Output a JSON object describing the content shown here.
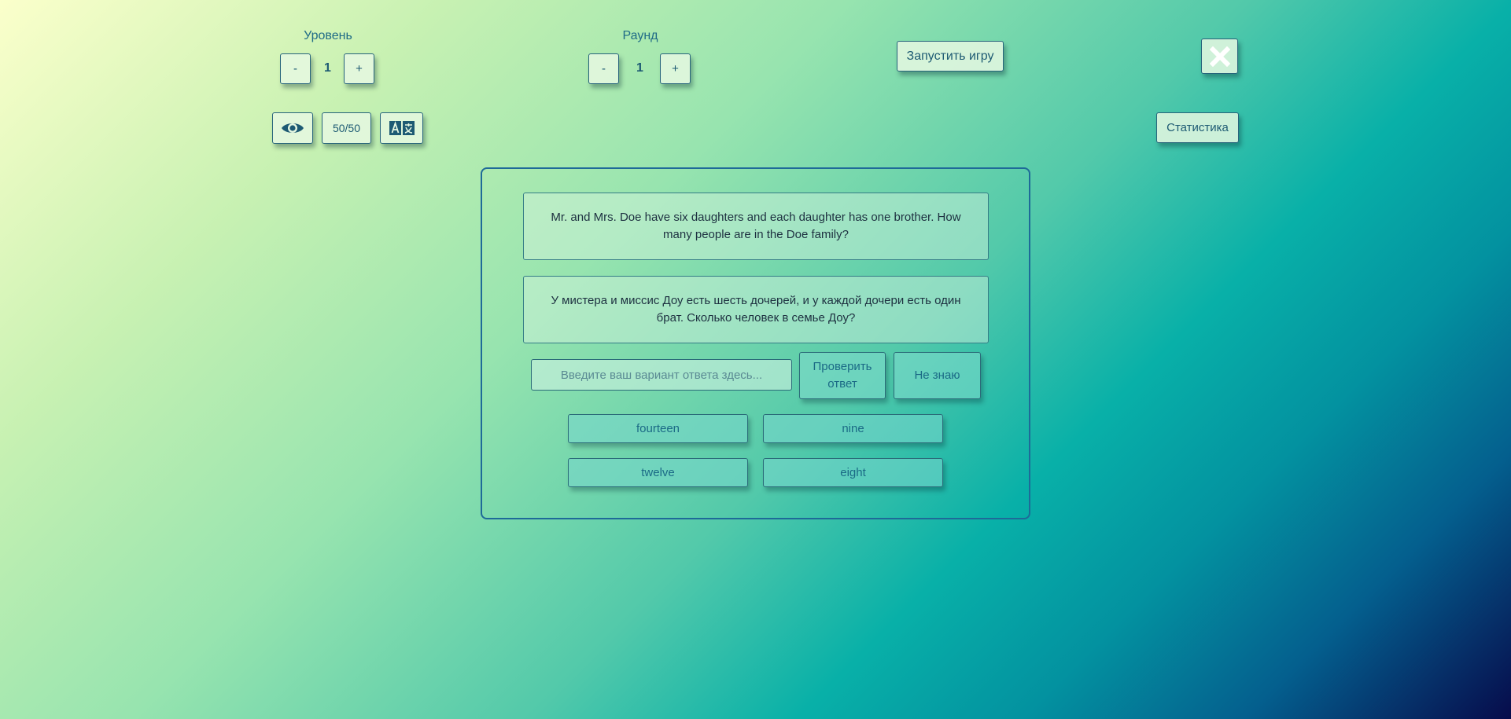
{
  "level": {
    "label": "Уровень",
    "minus": "-",
    "value": "1",
    "plus": "+"
  },
  "round": {
    "label": "Раунд",
    "minus": "-",
    "value": "1",
    "plus": "+"
  },
  "start_button": "Запустить игру",
  "close_icon": "close-icon",
  "tools": {
    "show_answer_icon": "eye-icon",
    "fifty_fifty": "50/50",
    "translate_icon": "translate-icon"
  },
  "stats_button": "Статистика",
  "question": {
    "english": "Mr. and Mrs. Doe have six daughters and each daughter has one brother. How many people are in the Doe family?",
    "russian": "У мистера и миссис Доу есть шесть дочерей, и у каждой дочери есть один брат. Сколько человек в семье Доу?"
  },
  "answer": {
    "placeholder": "Введите ваш вариант ответа здесь...",
    "value": "",
    "check_button": "Проверить ответ",
    "dont_know_button": "Не знаю"
  },
  "options": [
    "fourteen",
    "nine",
    "twelve",
    "eight"
  ],
  "colors": {
    "text": "#1d5a73",
    "card_border": "#1e6a98",
    "button_border": "#27647c"
  }
}
